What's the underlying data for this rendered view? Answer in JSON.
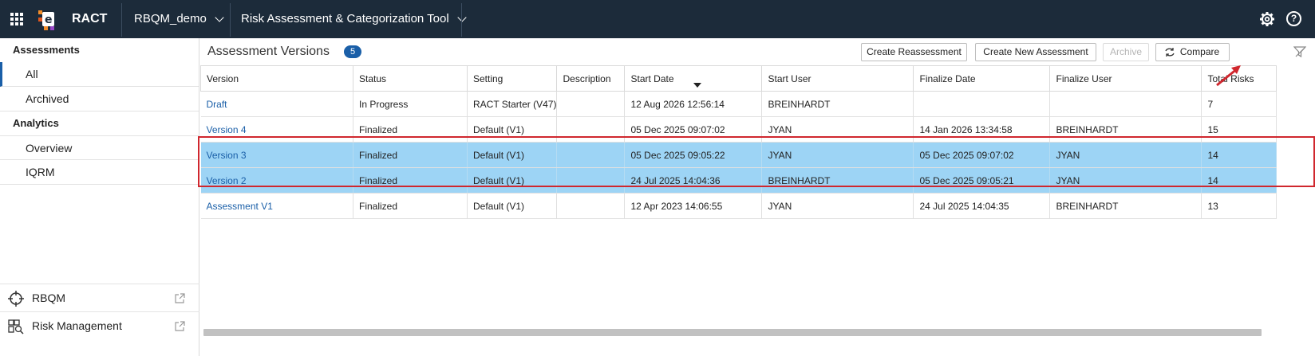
{
  "topbar": {
    "app_name": "RACT",
    "project_dropdown": "RBQM_demo",
    "tool_dropdown": "Risk Assessment & Categorization Tool",
    "icons": [
      "apps-grid-icon",
      "logo",
      "gear-icon",
      "help-icon"
    ],
    "help_glyph": "?",
    "bg_color": "#1c2b3a"
  },
  "sidebar": {
    "sections": [
      {
        "heading": "Assessments",
        "items": [
          "All",
          "Archived"
        ]
      },
      {
        "heading": "Analytics",
        "items": [
          "Overview",
          "IQRM"
        ]
      }
    ],
    "footer": [
      {
        "label": "RBQM",
        "icon": "crosshair-icon"
      },
      {
        "label": "Risk Management",
        "icon": "risk-management-icon"
      }
    ]
  },
  "main": {
    "title": "Assessment Versions",
    "count": "5",
    "buttons": {
      "create_reassessment": "Create Reassessment",
      "create_new": "Create New Assessment",
      "archive": "Archive",
      "compare": "Compare"
    },
    "columns": [
      "Version",
      "Status",
      "Setting",
      "Description",
      "Start Date",
      "Start User",
      "Finalize Date",
      "Finalize User",
      "Total Risks"
    ],
    "rows": [
      [
        "Draft",
        "In Progress",
        "RACT Starter (V47)",
        "",
        "12 Aug 2026 12:56:14",
        "BREINHARDT",
        "",
        "",
        "7"
      ],
      [
        "Version 4",
        "Finalized",
        "Default (V1)",
        "",
        "05 Dec 2025 09:07:02",
        "JYAN",
        "14 Jan 2026 13:34:58",
        "BREINHARDT",
        "15"
      ],
      [
        "Version 3",
        "Finalized",
        "Default (V1)",
        "",
        "05 Dec 2025 09:05:22",
        "JYAN",
        "05 Dec 2025 09:07:02",
        "JYAN",
        "14"
      ],
      [
        "Version 2",
        "Finalized",
        "Default (V1)",
        "",
        "24 Jul 2025 14:04:36",
        "BREINHARDT",
        "05 Dec 2025 09:05:21",
        "JYAN",
        "14"
      ],
      [
        "Assessment V1",
        "Finalized",
        "Default (V1)",
        "",
        "12 Apr 2023 14:06:55",
        "JYAN",
        "24 Jul 2025 14:04:35",
        "BREINHARDT",
        "13"
      ]
    ],
    "selected_rows": [
      2,
      3
    ],
    "colors": {
      "link": "#1a5fa8",
      "selected": "#9dd4f5",
      "highlight_box": "#d0272e"
    }
  }
}
